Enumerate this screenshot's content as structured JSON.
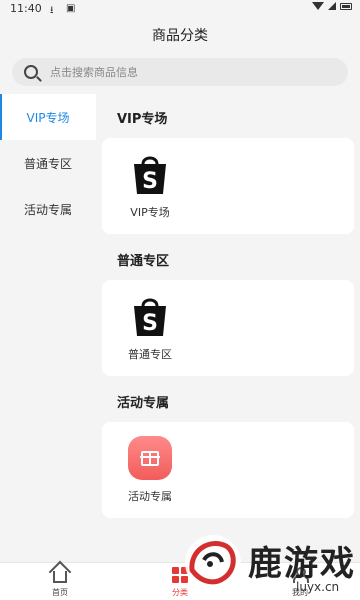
{
  "status_bar": {
    "time": "11:40"
  },
  "header": {
    "title": "商品分类"
  },
  "search": {
    "placeholder": "点击搜索商品信息"
  },
  "sidebar": {
    "items": [
      {
        "label": "VIP专场",
        "active": true
      },
      {
        "label": "普通专区",
        "active": false
      },
      {
        "label": "活动专属",
        "active": false
      }
    ]
  },
  "sections": [
    {
      "title": "VIP专场",
      "item_label": "VIP专场",
      "icon": "shopping-bag-icon"
    },
    {
      "title": "普通专区",
      "item_label": "普通专区",
      "icon": "shopping-bag-icon"
    },
    {
      "title": "活动专属",
      "item_label": "活动专属",
      "icon": "gift-icon"
    }
  ],
  "tabs": [
    {
      "label": "首页",
      "icon": "home-icon"
    },
    {
      "label": "分类",
      "icon": "category-icon",
      "active": true
    },
    {
      "label": "我的",
      "icon": "profile-icon"
    }
  ],
  "watermark": {
    "text": "鹿游戏",
    "url": "luyx.cn"
  },
  "colors": {
    "accent_blue": "#1e88e5",
    "accent_red": "#e53935",
    "gift_pink": "#f25c5c",
    "background": "#f4f4f4"
  }
}
